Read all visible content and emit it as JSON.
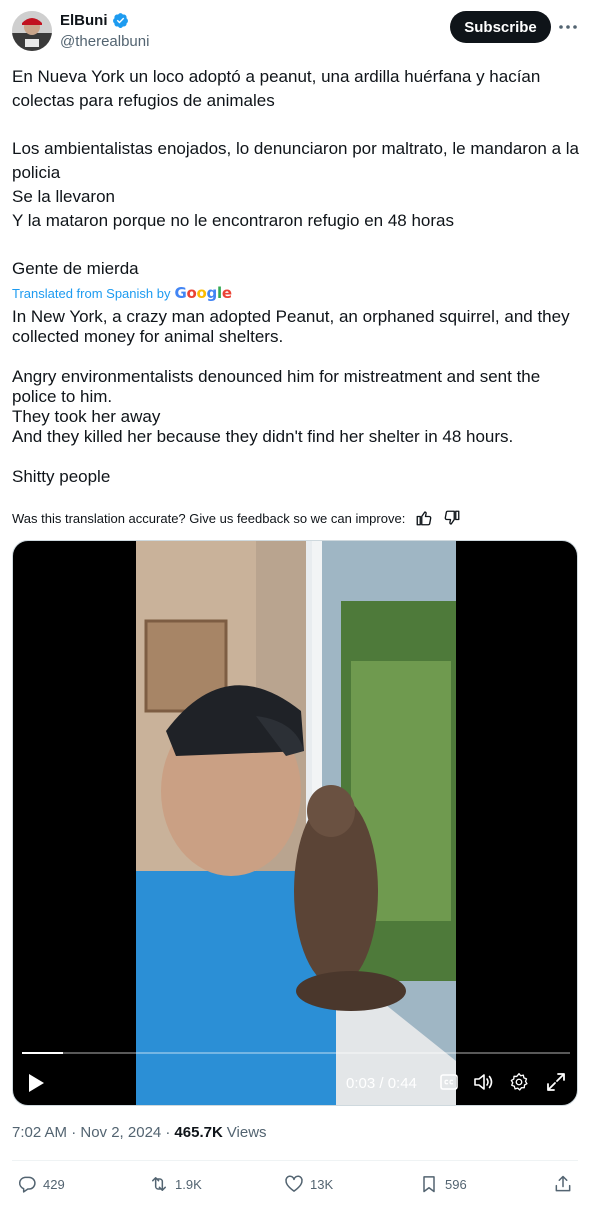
{
  "author": {
    "name": "ElBuni",
    "handle": "@therealbuni"
  },
  "subscribe_label": "Subscribe",
  "tweet": {
    "lines": [
      "En Nueva York un loco adoptó a peanut, una ardilla huérfana y hacían colectas para refugios de animales",
      "",
      "Los ambientalistas enojados, lo denunciaron por maltrato, le mandaron a la policia",
      "Se la llevaron",
      "Y la mataron porque no le encontraron refugio en 48 horas",
      "",
      "Gente de mierda"
    ]
  },
  "translation": {
    "label": "Translated from Spanish by",
    "provider": "Google",
    "lines": [
      "In New York, a crazy man adopted Peanut, an orphaned squirrel, and they collected money for animal shelters.",
      "",
      "Angry environmentalists denounced him for mistreatment and sent the police to him.",
      "They took her away",
      "And they killed her because they didn't find her shelter in 48 hours.",
      "",
      "Shitty people"
    ],
    "feedback": "Was this translation accurate? Give us feedback so we can improve:"
  },
  "video": {
    "time": "0:03 / 0:44",
    "progress": 0.075
  },
  "meta": {
    "timestamp": "7:02 AM · Nov 2, 2024 ·",
    "views": "465.7K",
    "views_label": "Views"
  },
  "actions": {
    "replies": "429",
    "reposts": "1.9K",
    "likes": "13K",
    "bookmarks": "596"
  },
  "colors": {
    "accent": "#1d9bf0",
    "text": "#0f1419",
    "secondary": "#536471"
  }
}
